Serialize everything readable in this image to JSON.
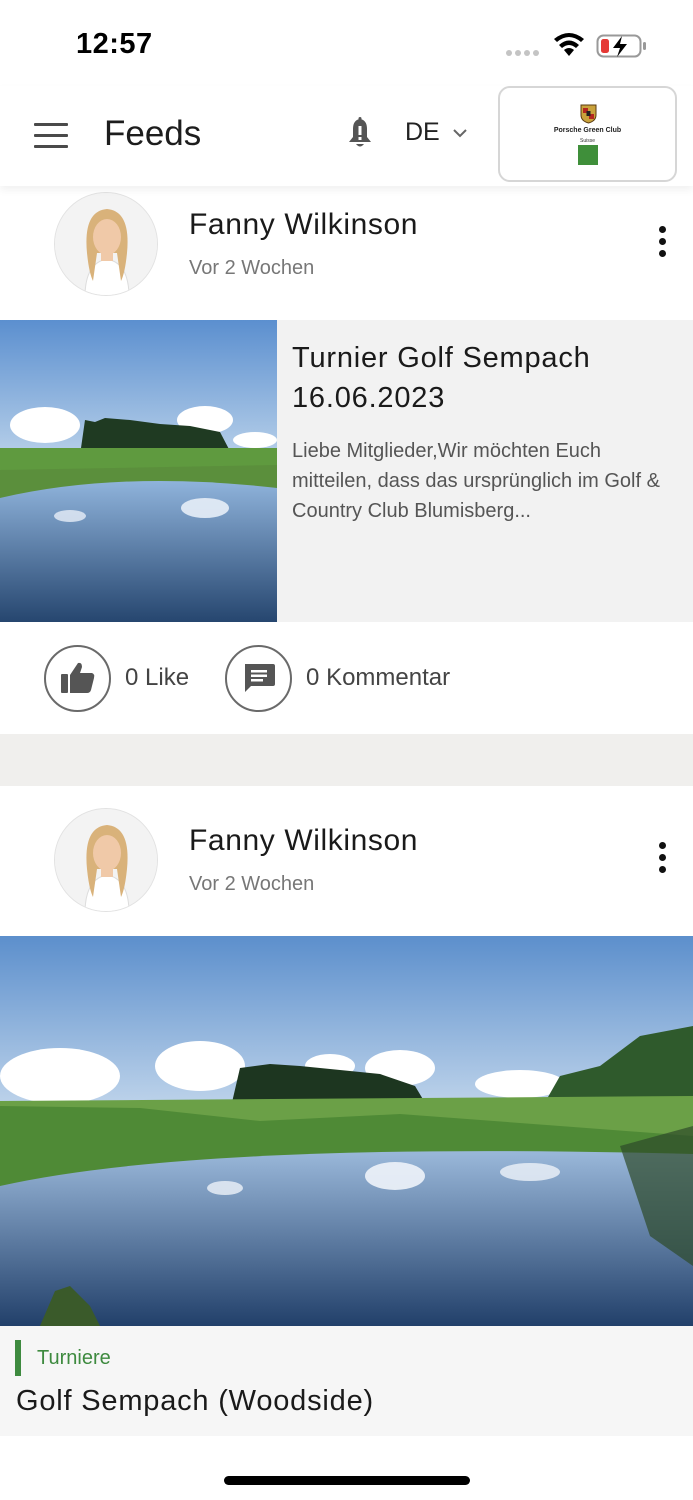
{
  "status_bar": {
    "time": "12:57",
    "icons": [
      "signal-icon",
      "wifi-icon",
      "battery-charging-icon"
    ]
  },
  "header": {
    "title": "Feeds",
    "language": "DE",
    "icons": [
      "menu-icon",
      "bell-icon",
      "chevron-down-icon"
    ],
    "logo": {
      "name": "Porsche Green Club",
      "sub": "Suisse"
    }
  },
  "posts": [
    {
      "author": "Fanny Wilkinson",
      "time": "Vor 2 Wochen",
      "title": "Turnier Golf Sempach 16.06.2023",
      "excerpt": "Liebe Mitglieder,Wir möchten Euch mitteilen, dass das ursprünglich im Golf & Country Club Blumisberg...",
      "likes": "0 Like",
      "comments": "0 Kommentar"
    },
    {
      "author": "Fanny Wilkinson",
      "time": "Vor 2 Wochen",
      "category": "Turniere",
      "title": "Golf Sempach (Woodside)"
    }
  ],
  "colors": {
    "accent_green": "#3e8a3f",
    "sky": "#6f9bd0",
    "water": "#3a5f8f"
  }
}
